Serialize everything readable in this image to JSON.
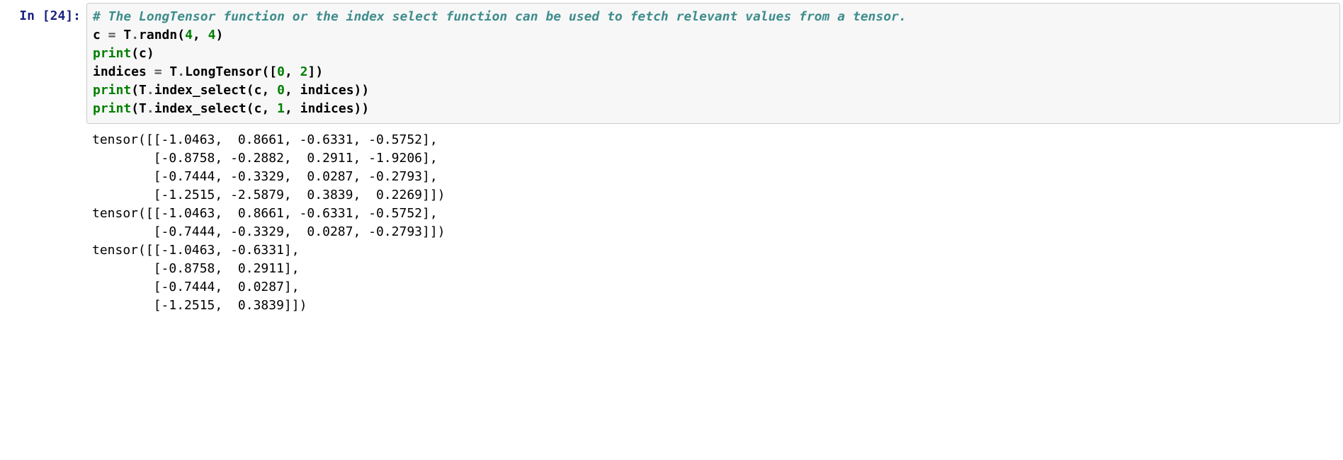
{
  "cell": {
    "prompt": {
      "in_label": "In ",
      "open": "[",
      "number": "24",
      "close": "]:"
    },
    "code": {
      "comment": "# The LongTensor function or the index select function can be used to fetch relevant values from a tensor.",
      "line1": {
        "var": "c",
        "eq": " = ",
        "obj": "T",
        "dot": ".",
        "fn": "randn",
        "lp": "(",
        "n1": "4",
        "comma": ", ",
        "n2": "4",
        "rp": ")"
      },
      "line2": {
        "fn": "print",
        "lp": "(",
        "arg": "c",
        "rp": ")"
      },
      "line3": {
        "var": "indices",
        "eq": " = ",
        "obj": "T",
        "dot": ".",
        "fn": "LongTensor",
        "lp": "([",
        "n1": "0",
        "comma": ", ",
        "n2": "2",
        "rp": "])"
      },
      "line4": {
        "fn": "print",
        "lp": "(",
        "obj": "T",
        "dot": ".",
        "fn2": "index_select",
        "lp2": "(",
        "arg1": "c",
        "c1": ", ",
        "n": "0",
        "c2": ", ",
        "arg2": "indices",
        "rp2": ")",
        "rp": ")"
      },
      "line5": {
        "fn": "print",
        "lp": "(",
        "obj": "T",
        "dot": ".",
        "fn2": "index_select",
        "lp2": "(",
        "arg1": "c",
        "c1": ", ",
        "n": "1",
        "c2": ", ",
        "arg2": "indices",
        "rp2": ")",
        "rp": ")"
      }
    },
    "output": "tensor([[-1.0463,  0.8661, -0.6331, -0.5752],\n        [-0.8758, -0.2882,  0.2911, -1.9206],\n        [-0.7444, -0.3329,  0.0287, -0.2793],\n        [-1.2515, -2.5879,  0.3839,  0.2269]])\ntensor([[-1.0463,  0.8661, -0.6331, -0.5752],\n        [-0.7444, -0.3329,  0.0287, -0.2793]])\ntensor([[-1.0463, -0.6331],\n        [-0.8758,  0.2911],\n        [-0.7444,  0.0287],\n        [-1.2515,  0.3839]])"
  }
}
